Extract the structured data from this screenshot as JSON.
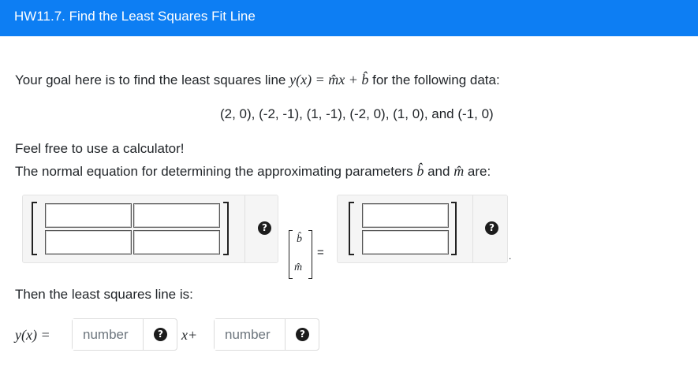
{
  "header": {
    "title": "HW11.7. Find the Least Squares Fit Line"
  },
  "intro": {
    "prefix": "Your goal here is to find the least squares line",
    "equation": "y(x) = m̂x + b̂",
    "suffix": "for the following data:"
  },
  "data_points": "(2, 0), (-2, -1), (1, -1), (-2, 0), (1, 0), and (-1, 0)",
  "calculator_note": "Feel free to use a calculator!",
  "normal_eq": {
    "prefix": "The normal equation for determining the approximating parameters",
    "b_hat": "b̂",
    "and": "and",
    "m_hat": "m̂",
    "suffix": "are:",
    "vector_top": "b̂",
    "vector_bottom": "m̂",
    "equals": "=",
    "period": "."
  },
  "help_symbol": "?",
  "then_line": "Then the least squares line is:",
  "answer": {
    "lhs": "y(x) =",
    "x_plus": "x+",
    "slope_placeholder": "number",
    "intercept_placeholder": "number"
  }
}
